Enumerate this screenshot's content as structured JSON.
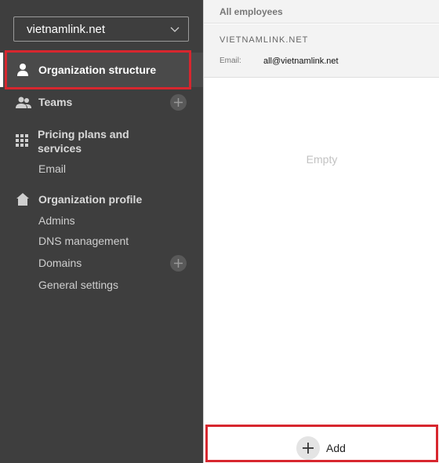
{
  "sidebar": {
    "org_selector": {
      "value": "vietnamlink.net"
    },
    "nav": {
      "org_structure": "Organization structure",
      "teams": "Teams",
      "pricing": "Pricing plans and services",
      "email": "Email",
      "org_profile": "Organization profile",
      "admins": "Admins",
      "dns": "DNS management",
      "domains": "Domains",
      "general_settings": "General settings"
    }
  },
  "main": {
    "header_title": "All employees",
    "card": {
      "name": "VIETNAMLINK.NET",
      "email_label": "Email:",
      "email_value": "all@vietnamlink.net"
    },
    "empty_text": "Empty",
    "add_label": "Add"
  },
  "colors": {
    "sidebar_bg": "#3e3e3e",
    "highlight": "#d7262e"
  }
}
